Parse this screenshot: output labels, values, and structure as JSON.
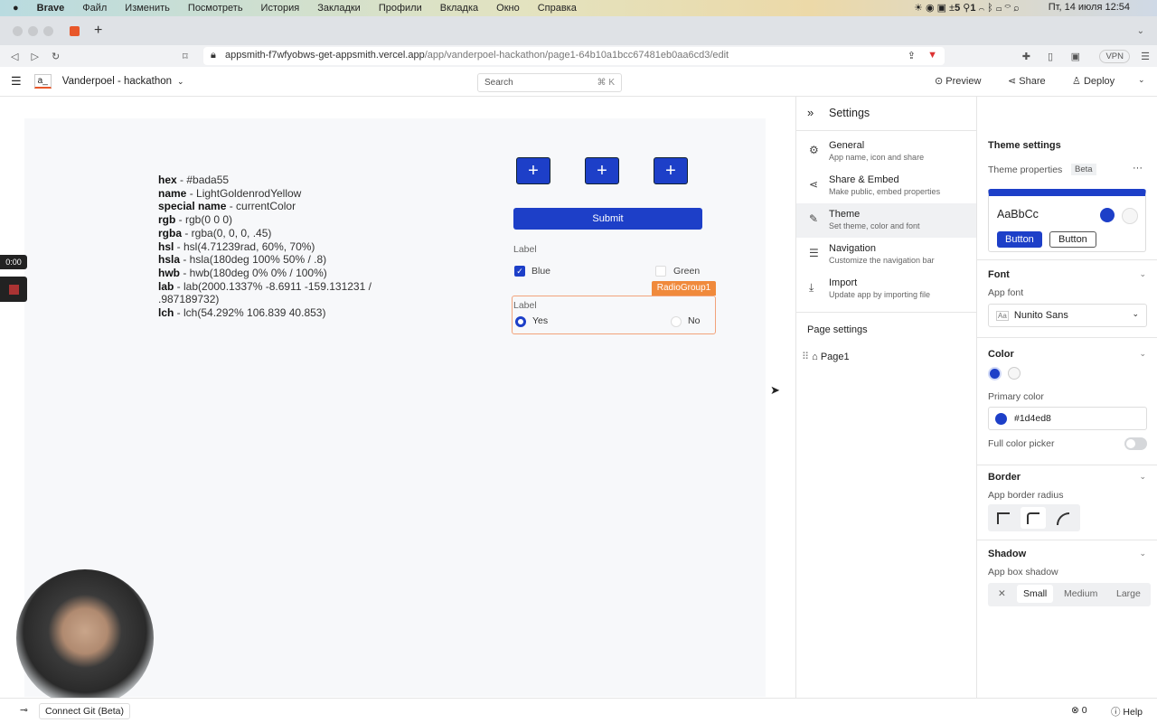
{
  "menubar": {
    "items": [
      "Brave",
      "Файл",
      "Изменить",
      "Посмотреть",
      "История",
      "Закладки",
      "Профили",
      "Вкладка",
      "Окно",
      "Справка"
    ],
    "status": "5",
    "status2": "1",
    "datetime": "Пт, 14 июля  12:54"
  },
  "browser": {
    "url_host": "appsmith-f7wfyobws-get-appsmith.vercel.app",
    "url_path": "/app/vanderpoel-hackathon/page1-64b10a1bcc67481eb0aa6cd3/edit",
    "vpn": "VPN"
  },
  "app": {
    "logo": "a_",
    "title": "Vanderpoel - hackathon",
    "search_placeholder": "Search",
    "search_shortcut": "⌘ K",
    "preview": "Preview",
    "share": "Share",
    "deploy": "Deploy"
  },
  "canvas": {
    "lines": [
      {
        "k": "hex",
        "v": " - #bada55"
      },
      {
        "k": "name",
        "v": " - LightGoldenrodYellow"
      },
      {
        "k": "special name",
        "v": " - currentColor"
      },
      {
        "k": "rgb",
        "v": " - rgb(0 0 0)"
      },
      {
        "k": "rgba",
        "v": " - rgba(0, 0, 0, .45)"
      },
      {
        "k": "hsl",
        "v": " - hsl(4.71239rad, 60%, 70%)"
      },
      {
        "k": "hsla",
        "v": " - hsla(180deg 100% 50% / .8)"
      },
      {
        "k": "hwb",
        "v": " - hwb(180deg 0% 0% / 100%)"
      },
      {
        "k": "lab",
        "v": " - lab(2000.1337% -8.6911 -159.131231 / .987189732)"
      },
      {
        "k": "lch",
        "v": " - lch(54.292% 106.839 40.853)"
      }
    ],
    "plus": "+",
    "submit": "Submit",
    "checkbox_label": "Label",
    "checkbox_options": [
      {
        "label": "Blue",
        "checked": true
      },
      {
        "label": "Green",
        "checked": false
      }
    ],
    "radio_tag": "RadioGroup1",
    "radio_label": "Label",
    "radio_options": [
      {
        "label": "Yes",
        "selected": true
      },
      {
        "label": "No",
        "selected": false
      }
    ],
    "timer": "0:00"
  },
  "settings": {
    "title": "Settings",
    "items": [
      {
        "title": "General",
        "desc": "App name, icon and share"
      },
      {
        "title": "Share & Embed",
        "desc": "Make public, embed properties"
      },
      {
        "title": "Theme",
        "desc": "Set theme, color and font"
      },
      {
        "title": "Navigation",
        "desc": "Customize the navigation bar"
      },
      {
        "title": "Import",
        "desc": "Update app by importing file"
      }
    ],
    "page_settings": "Page settings",
    "page": "Page1"
  },
  "theme": {
    "title": "Theme settings",
    "props": "Theme properties",
    "beta": "Beta",
    "more": "···",
    "sample": "AaBbCc",
    "btn1": "Button",
    "btn2": "Button",
    "font": "Font",
    "app_font": "App font",
    "font_value": "Nunito Sans",
    "font_icon": "Aa",
    "color": "Color",
    "primary_color_label": "Primary color",
    "primary_color": "#1d4ed8",
    "full_picker": "Full color picker",
    "border": "Border",
    "border_radius": "App border radius",
    "shadow": "Shadow",
    "box_shadow": "App box shadow",
    "shadow_opts": [
      "✕",
      "Small",
      "Medium",
      "Large"
    ]
  },
  "bottom": {
    "git": "Connect Git (Beta)",
    "errors": "0",
    "help": "Help"
  },
  "colors": {
    "primary": "#1d3fc8",
    "orange": "#f08a3c"
  }
}
